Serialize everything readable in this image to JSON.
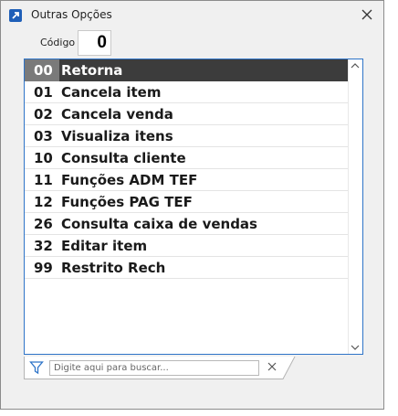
{
  "window": {
    "title": "Outras Opções"
  },
  "code": {
    "label": "Código",
    "value": "0"
  },
  "options": [
    {
      "code": "00",
      "label": "Retorna",
      "selected": true
    },
    {
      "code": "01",
      "label": "Cancela item"
    },
    {
      "code": "02",
      "label": "Cancela venda"
    },
    {
      "code": "03",
      "label": "Visualiza itens"
    },
    {
      "code": "10",
      "label": "Consulta cliente"
    },
    {
      "code": "11",
      "label": "Funções ADM TEF"
    },
    {
      "code": "12",
      "label": "Funções PAG TEF"
    },
    {
      "code": "26",
      "label": "Consulta caixa de vendas"
    },
    {
      "code": "32",
      "label": "Editar item"
    },
    {
      "code": "99",
      "label": "Restrito Rech"
    }
  ],
  "search": {
    "placeholder": "Digite aqui para buscar..."
  },
  "icons": {
    "app": "app-arrow-icon",
    "close": "close-icon",
    "scroll_up": "chevron-up-icon",
    "scroll_down": "chevron-down-icon",
    "filter": "filter-icon",
    "clear": "clear-icon"
  },
  "colors": {
    "accent": "#2e74c8",
    "selected_row": "#3c3c3c",
    "selected_code": "#7a7a7a"
  }
}
